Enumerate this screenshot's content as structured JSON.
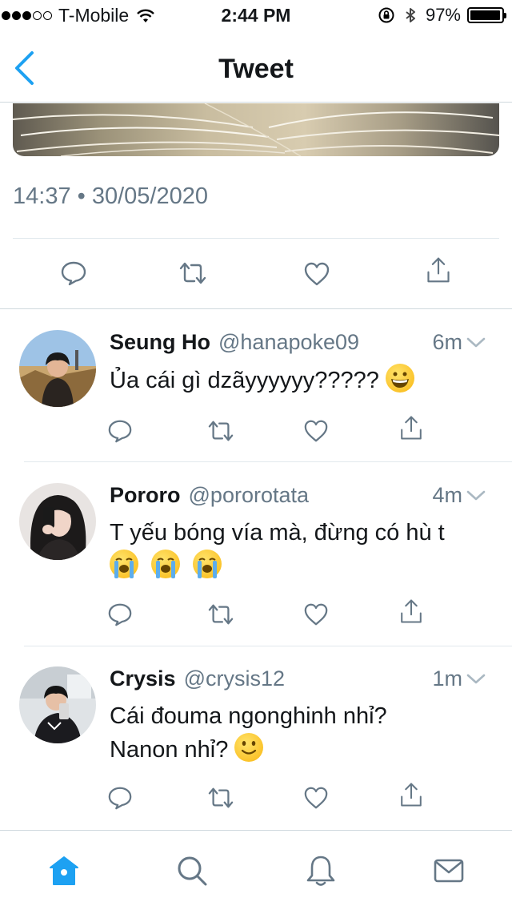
{
  "status_bar": {
    "carrier": "T-Mobile",
    "time": "2:44 PM",
    "battery_percent": "97%",
    "battery_level": 0.97,
    "signal_bars_filled": 3,
    "signal_bars_total": 5
  },
  "nav": {
    "title": "Tweet",
    "back_icon": "chevron-left-icon"
  },
  "tweet": {
    "timestamp": "14:37 • 30/05/2020",
    "actions": [
      "reply-icon",
      "retweet-icon",
      "like-icon",
      "share-icon"
    ]
  },
  "replies": [
    {
      "name": "Seung Ho",
      "handle": "@hanapoke09",
      "time_ago": "6m",
      "text": "Ủa cái gì dzãyyyyyy?????"
    },
    {
      "name": "Pororo",
      "handle": "@pororotata",
      "time_ago": "4m",
      "text": "T yếu bóng vía mà, đừng có hù t"
    },
    {
      "name": "Crysis",
      "handle": "@crysis12",
      "time_ago": "1m",
      "text_line1": "Cái đouma ngonghinh nhỉ?",
      "text_line2": "Nanon nhỉ?"
    }
  ],
  "tabbar": {
    "tabs": [
      "home-icon",
      "search-icon",
      "notifications-icon",
      "messages-icon"
    ],
    "active_tab": "home-icon"
  },
  "colors": {
    "accent": "#1da1f2",
    "icon_gray": "#657786",
    "text": "#14171a",
    "divider": "#e1e8ed",
    "emoji_yellow": "#f9b712"
  }
}
